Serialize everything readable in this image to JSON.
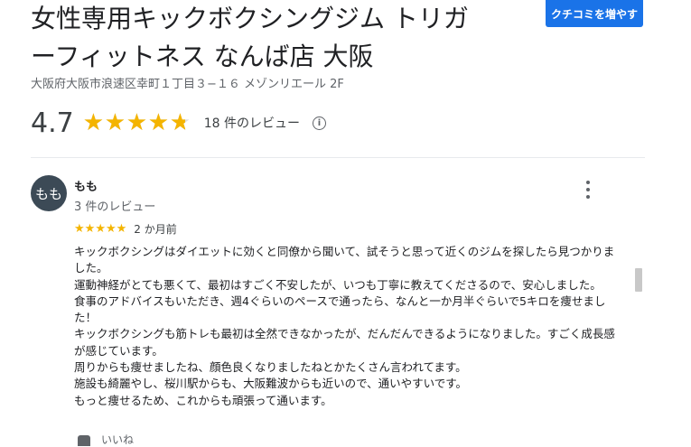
{
  "place": {
    "title_line1": "女性専用キックボクシングジム トリガ",
    "title_line2": "ーフィットネス なんば店 大阪",
    "address": "大阪府大阪市浪速区幸町１丁目３−１６ メゾンリエール 2F",
    "write_review_button": "クチコミを増やす"
  },
  "rating": {
    "value": "4.7",
    "stars_filled": 4.7,
    "review_count": "18 件のレビュー",
    "info_icon": "info-icon"
  },
  "review": {
    "avatar_text": "もも",
    "reviewer_name": "もも",
    "reviewer_review_count": "3 件のレビュー",
    "star_rating": 5,
    "date": "2 か月前",
    "body_lines": [
      "キックボクシングはダイエットに効くと同僚から聞いて、試そうと思って近くのジムを探したら見つかりました。",
      "運動神経がとても悪くて、最初はすごく不安したが、いつも丁寧に教えてくださるので、安心しました。",
      "食事のアドバイスもいただき、週4ぐらいのペースで通ったら、なんと一か月半ぐらいで5キロを痩せました！",
      "キックボクシングも筋トレも最初は全然できなかったが、だんだんできるようになりました。すごく成長感が感じています。",
      "周りからも痩せましたね、顔色良くなりましたねとかたくさん言われてます。",
      "施設も綺麗やし、桜川駅からも、大阪難波からも近いので、通いやすいです。",
      "もっと痩せるため、これからも頑張って通います。"
    ],
    "like_label": "いいね"
  },
  "colors": {
    "accent": "#1a73e8",
    "star": "#f4b400",
    "avatar_bg": "#3c4a56"
  }
}
